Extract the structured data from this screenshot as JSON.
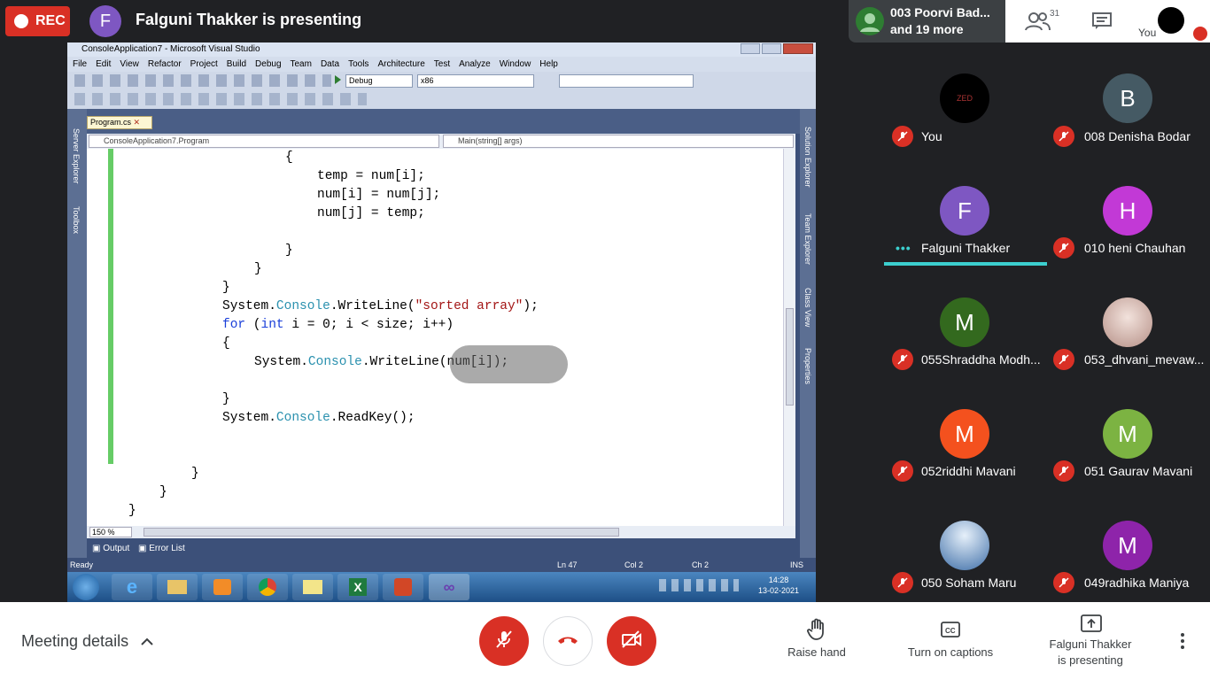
{
  "meet": {
    "rec_label": "REC",
    "presenter_initial": "F",
    "presenter_title": "Falguni Thakker is presenting",
    "top_participant": "003 Poorvi Bad...",
    "top_more": "and 19 more",
    "people_count": "31",
    "self_label": "You"
  },
  "vs": {
    "window_title": "ConsoleApplication7 - Microsoft Visual Studio",
    "menu": [
      "File",
      "Edit",
      "View",
      "Refactor",
      "Project",
      "Build",
      "Debug",
      "Team",
      "Data",
      "Tools",
      "Architecture",
      "Test",
      "Analyze",
      "Window",
      "Help"
    ],
    "config": "Debug",
    "platform": "x86",
    "tab": "Program.cs",
    "nav_left": "ConsoleApplication7.Program",
    "nav_right": "Main(string[] args)",
    "left_strip": "Server Explorer",
    "left_strip2": "Toolbox",
    "right_strip1": "Solution Explorer",
    "right_strip2": "Team Explorer",
    "right_strip3": "Class View",
    "right_strip4": "Properties",
    "zoom": "150 %",
    "dock_output": "Output",
    "dock_errors": "Error List",
    "status_ready": "Ready",
    "status_ln": "Ln 47",
    "status_col": "Col 2",
    "status_ch": "Ch 2",
    "status_ins": "INS",
    "clock_time": "14:28",
    "clock_date": "13-02-2021"
  },
  "participants": [
    {
      "name": "You",
      "initial": "",
      "color": "#000000"
    },
    {
      "name": "008 Denisha Bodar",
      "initial": "B",
      "color": "#455a64"
    },
    {
      "name": "Falguni Thakker",
      "initial": "F",
      "color": "#7e57c2"
    },
    {
      "name": "010 heni Chauhan",
      "initial": "H",
      "color": "#c239d6"
    },
    {
      "name": "055Shraddha Modh...",
      "initial": "M",
      "color": "#33691e"
    },
    {
      "name": "053_dhvani_mevaw...",
      "initial": "",
      "color": "#d9c6c0"
    },
    {
      "name": "052riddhi Mavani",
      "initial": "M",
      "color": "#f4511e"
    },
    {
      "name": "051 Gaurav Mavani",
      "initial": "M",
      "color": "#7cb342"
    },
    {
      "name": "050 Soham Maru",
      "initial": "",
      "color": "#5b8fc9"
    },
    {
      "name": "049radhika Maniya",
      "initial": "M",
      "color": "#8e24aa"
    }
  ],
  "bottom": {
    "meeting_details": "Meeting details",
    "raise_hand": "Raise hand",
    "captions": "Turn on captions",
    "presenting_line1": "Falguni Thakker",
    "presenting_line2": "is presenting"
  },
  "colors": {
    "danger": "#d93025",
    "accent": "#3ccfcf",
    "panel": "#202124"
  }
}
